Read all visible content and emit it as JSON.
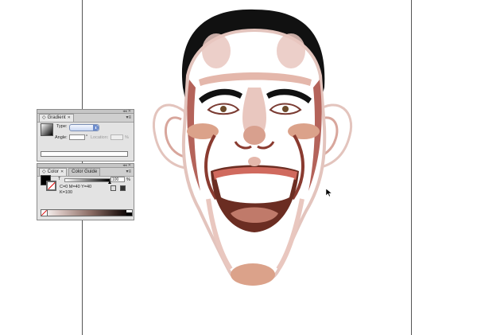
{
  "gradient_panel": {
    "tab_title": "Gradient",
    "tab_close": "✕",
    "panel_top_controls": "◂◂ ✕",
    "menu_glyph": "▾≡",
    "type_label": "Type:",
    "type_value": "",
    "angle_label": "Angle:",
    "angle_value": "",
    "angle_unit": "°",
    "location_label": "Location:",
    "location_value": "",
    "location_unit": "%"
  },
  "color_panel": {
    "tab_color": "Color",
    "tab_close": "✕",
    "tab_color_guide": "Color Guide",
    "panel_top_controls": "◂◂ ✕",
    "menu_glyph": "▾≡",
    "tint_label": "T",
    "tint_value": "100",
    "tint_unit": "%",
    "tint_level": 1.0,
    "cmyk_line1": "C=0 M=40 Y=40",
    "cmyk_line2": "K=100"
  },
  "icons": {
    "cursor": "arrow-cursor-icon",
    "menu": "panel-menu-icon",
    "close": "close-icon",
    "collapse": "collapse-icon"
  },
  "colors": {
    "hair": "#111111",
    "skin": "#ffffff",
    "skin_shade": "#e9c7bf",
    "skin_dark": "#a0524a",
    "cheek": "#dba28a",
    "mouth": "#6b2d22",
    "tongue": "#c07a6a",
    "gums": "#d06a5e",
    "panel_bg": "#e3e3e3"
  }
}
